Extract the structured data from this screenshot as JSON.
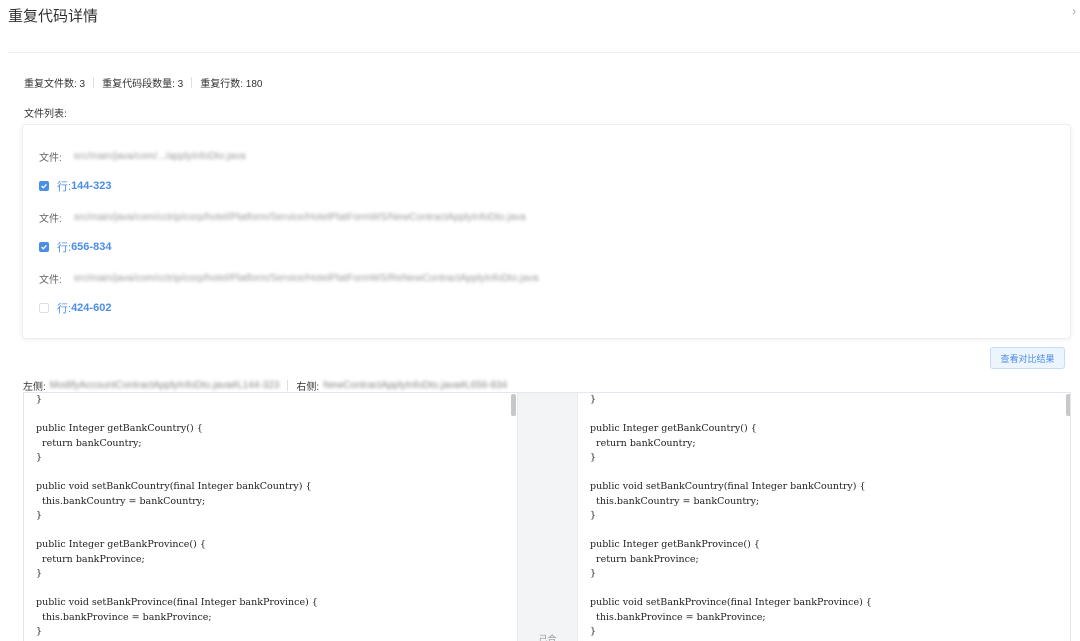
{
  "dialog": {
    "title": "重复代码详情",
    "close_glyph": "›"
  },
  "stats": {
    "files": "重复文件数: 3",
    "segments": "重复代码段数量: 3",
    "lines": "重复行数: 180"
  },
  "file_list": {
    "label": "文件列表:",
    "items": [
      {
        "file_label": "文件:",
        "path": "src/main/java/com/.../applyInfoDto.java",
        "line_prefix": "行:",
        "line_range": "144-323",
        "checked": true
      },
      {
        "file_label": "文件:",
        "path": "src/main/java/com/cctrip/corp/hotel/Platform/Service/HotelPlatFormWS/NewContractApplyInfoDto.java",
        "line_prefix": "行:",
        "line_range": "656-834",
        "checked": true
      },
      {
        "file_label": "文件:",
        "path": "src/main/java/com/cctrip/corp/hotel/Platform/Service/HotelPlatFormWS/ReNewContractApplyInfoDto.java",
        "line_prefix": "行:",
        "line_range": "424-602",
        "checked": false
      }
    ]
  },
  "compare_button": "查看对比结果",
  "compare": {
    "left_key": "左侧:",
    "left_value": "ModifyAccountContractApplyInfoDto.java#L144-323",
    "right_key": "右侧:",
    "right_value": "NewContractApplyInfoDto.java#L656-834",
    "gutter_label": "己合"
  },
  "code_left": [
    "}",
    "",
    "public Integer getBankCountry() {",
    "  return bankCountry;",
    "}",
    "",
    "public void setBankCountry(final Integer bankCountry) {",
    "  this.bankCountry = bankCountry;",
    "}",
    "",
    "public Integer getBankProvince() {",
    "  return bankProvince;",
    "}",
    "",
    "public void setBankProvince(final Integer bankProvince) {",
    "  this.bankProvince = bankProvince;",
    "}"
  ],
  "code_right": [
    "}",
    "",
    "public Integer getBankCountry() {",
    "  return bankCountry;",
    "}",
    "",
    "public void setBankCountry(final Integer bankCountry) {",
    "  this.bankCountry = bankCountry;",
    "}",
    "",
    "public Integer getBankProvince() {",
    "  return bankProvince;",
    "}",
    "",
    "public void setBankProvince(final Integer bankProvince) {",
    "  this.bankProvince = bankProvince;",
    "}"
  ],
  "colors": {
    "accent": "#4b8ee8",
    "border": "#ebeef5",
    "gutter": "#f3f4f6"
  }
}
